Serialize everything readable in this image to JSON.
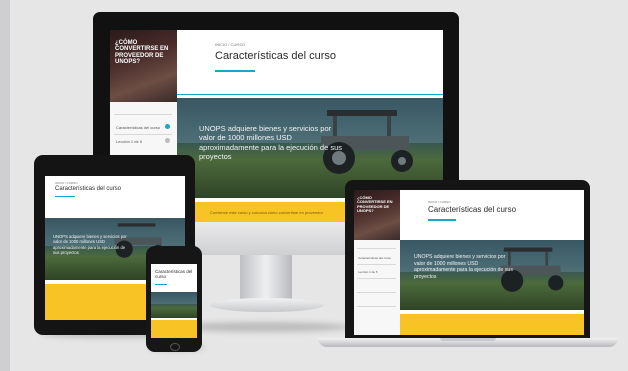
{
  "course": {
    "sidebar_title": "¿CÓMO CONVERTIRSE EN PROVEEDOR DE UNOPS?",
    "menu_items": [
      "Características del curso",
      "Lección 1 de 5"
    ],
    "kicker": "INICIO / CURSO",
    "heading": "Características del curso",
    "hero_text": "UNOPS adquiere bienes y servicios por valor de 1000 millones USD aproximadamente para la ejecución de sus proyectos",
    "yellow_text": "Comience este curso y conozca cómo convertirse en proveedor"
  },
  "colors": {
    "accent": "#18a7c4",
    "banner": "#f7c325",
    "sidebar_hero": "#4b2d2b",
    "background": "#e6e6e7"
  },
  "devices": [
    "desktop-monitor",
    "tablet",
    "smartphone",
    "laptop"
  ]
}
